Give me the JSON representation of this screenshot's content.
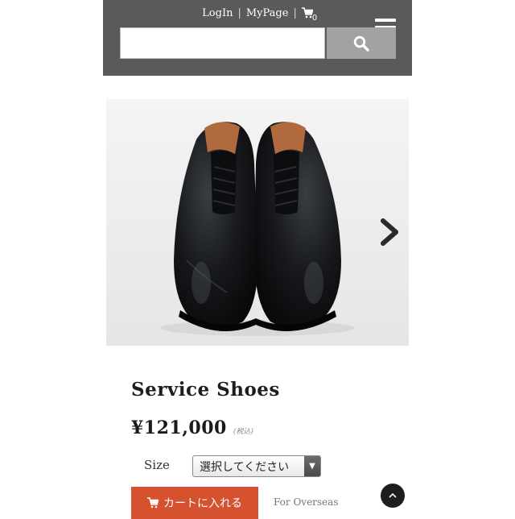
{
  "header": {
    "login_label": "LogIn",
    "mypage_label": "MyPage",
    "separator": "|",
    "cart_count": "0",
    "search": {
      "value": "",
      "placeholder": ""
    }
  },
  "gallery": {
    "image_subject": "black leather service shoes",
    "next_icon": "chevron-right-icon"
  },
  "product": {
    "title": "Service Shoes",
    "price": "¥121,000",
    "tax_note": "(税込)",
    "size_label": "Size",
    "size_selected": "選択してください"
  },
  "actions": {
    "cart_button_label": "カートに入れる",
    "overseas_label": "For Overseas"
  },
  "colors": {
    "header_bg": "#5a5a5a",
    "search_button_bg": "#a2a2a2",
    "cart_button_bg": "#d6512e",
    "to_top_bg": "#1e1e1e"
  }
}
